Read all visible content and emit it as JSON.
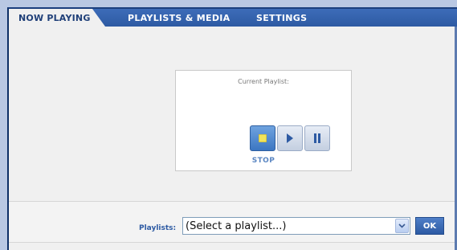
{
  "tabs": [
    {
      "label": "NOW PLAYING",
      "active": true
    },
    {
      "label": "PLAYLISTS & MEDIA",
      "active": false
    },
    {
      "label": "SETTINGS",
      "active": false
    }
  ],
  "player": {
    "current_playlist_label": "Current Playlist:",
    "controls": [
      {
        "icon": "stop-icon",
        "active": true
      },
      {
        "icon": "play-icon",
        "active": false
      },
      {
        "icon": "pause-icon",
        "active": false
      }
    ],
    "status_label": "STOP"
  },
  "playlist_selector": {
    "label": "Playlists:",
    "selected_value": "(Select a playlist...)",
    "ok_label": "OK"
  },
  "colors": {
    "accent": "#2d5aa3",
    "tab_bar": "#3d6cb9",
    "stop_glyph": "#f2e45a"
  }
}
